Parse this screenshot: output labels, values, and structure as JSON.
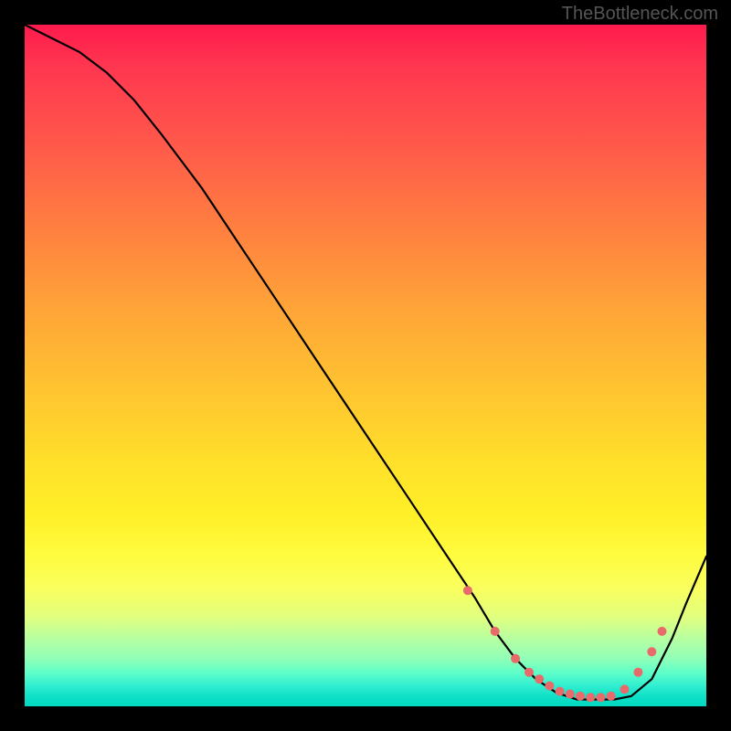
{
  "watermark": "TheBottleneck.com",
  "chart_data": {
    "type": "line",
    "title": "",
    "xlabel": "",
    "ylabel": "",
    "xlim": [
      0,
      100
    ],
    "ylim": [
      0,
      100
    ],
    "series": [
      {
        "name": "curve",
        "x": [
          0,
          4,
          8,
          12,
          16,
          20,
          26,
          32,
          38,
          44,
          50,
          56,
          62,
          66,
          69,
          72,
          75,
          78,
          81,
          84,
          86.5,
          89,
          92,
          95,
          97,
          100
        ],
        "values": [
          100,
          98,
          96,
          93,
          89,
          84,
          76,
          67,
          58,
          49,
          40,
          31,
          22,
          16,
          11,
          7,
          4,
          2,
          1,
          1,
          1,
          1.5,
          4,
          10,
          15,
          22
        ]
      }
    ],
    "markers": {
      "name": "dots",
      "x": [
        65,
        69,
        72,
        74,
        75.5,
        77,
        78.5,
        80,
        81.5,
        83,
        84.5,
        86,
        88,
        90,
        92,
        93.5
      ],
      "values": [
        17,
        11,
        7,
        5,
        4,
        3,
        2.2,
        1.8,
        1.5,
        1.3,
        1.3,
        1.5,
        2.5,
        5,
        8,
        11
      ],
      "color": "#e86a6a",
      "radius": 5
    },
    "background_gradient": {
      "orientation": "vertical",
      "stops": [
        {
          "pos": 0.0,
          "color": "#ff1a4d"
        },
        {
          "pos": 0.3,
          "color": "#ff8040"
        },
        {
          "pos": 0.6,
          "color": "#ffdf2a"
        },
        {
          "pos": 0.82,
          "color": "#fff840"
        },
        {
          "pos": 0.92,
          "color": "#a0ffb0"
        },
        {
          "pos": 1.0,
          "color": "#00d8c0"
        }
      ]
    },
    "grid": false,
    "legend": false
  }
}
